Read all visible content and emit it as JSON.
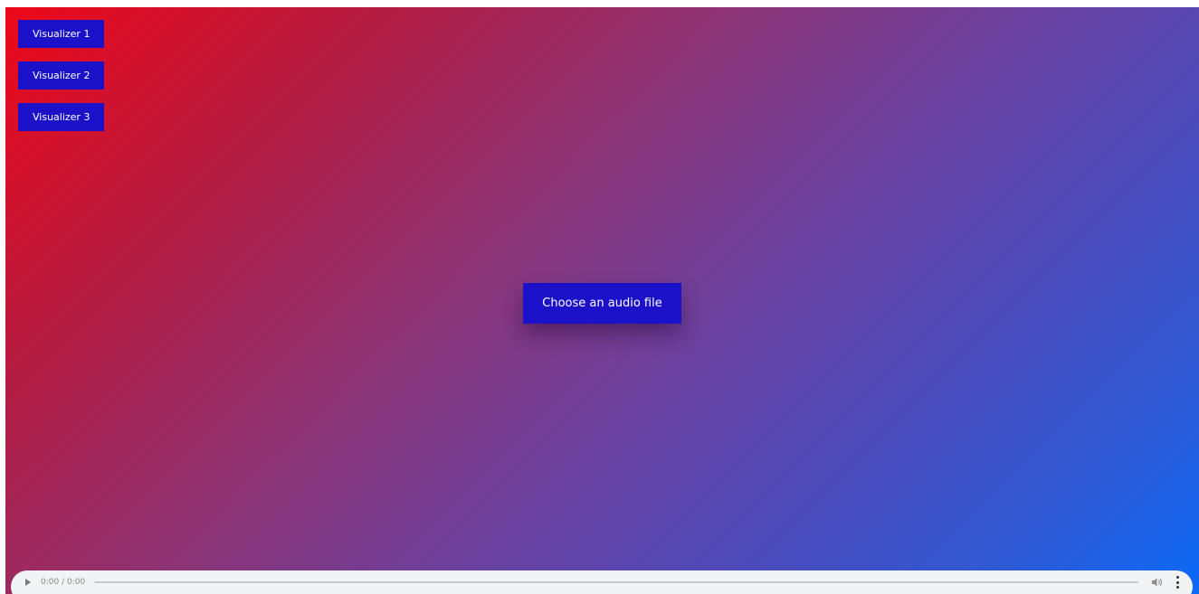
{
  "visualizers": [
    {
      "label": "Visualizer 1"
    },
    {
      "label": "Visualizer 2"
    },
    {
      "label": "Visualizer 3"
    }
  ],
  "upload": {
    "label": "Choose an audio file"
  },
  "player": {
    "time": "0:00 / 0:00",
    "progress": 0
  },
  "colors": {
    "button": "#1a11c9",
    "gradient_start": "#ee0818",
    "gradient_end": "#0a6af8"
  },
  "icons": {
    "play": "play-icon",
    "volume": "volume-icon",
    "menu": "more-vert-icon"
  }
}
